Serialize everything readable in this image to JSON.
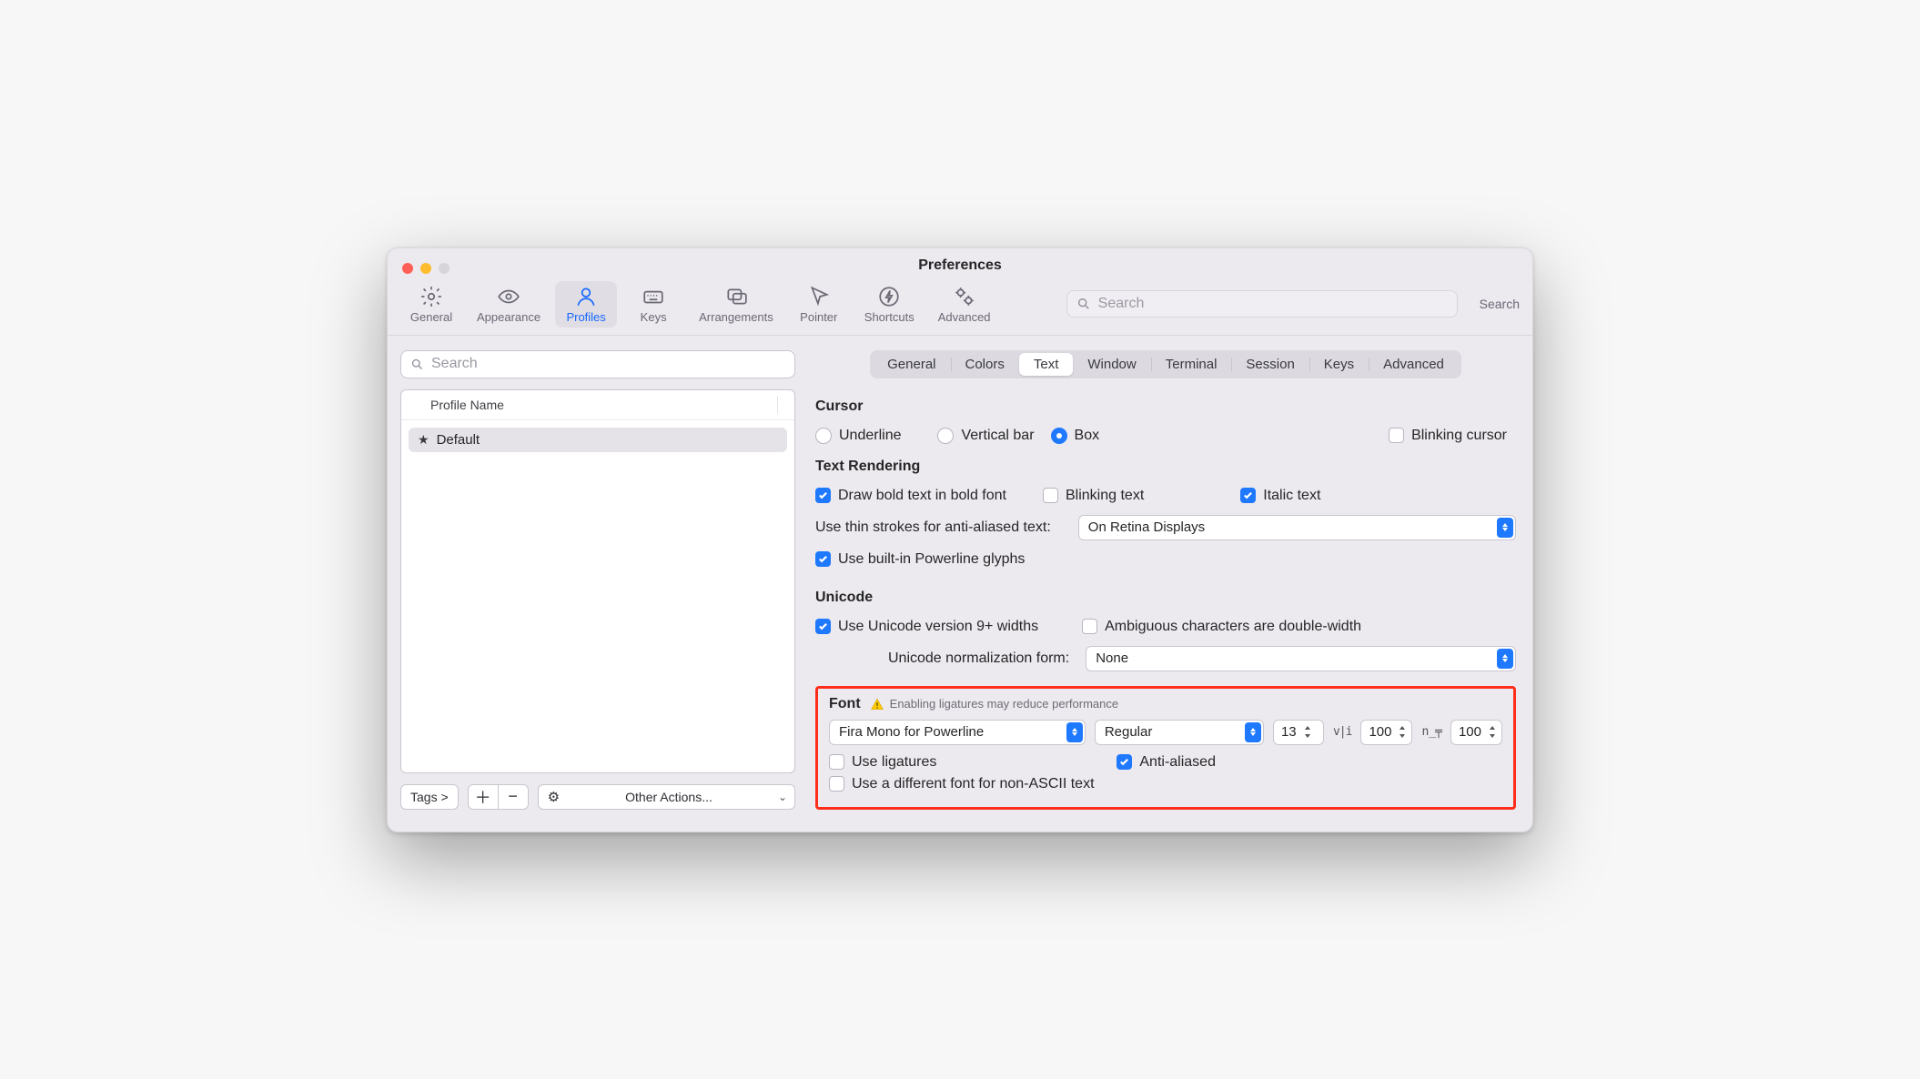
{
  "window": {
    "title": "Preferences"
  },
  "toolbar": {
    "items": [
      {
        "label": "General"
      },
      {
        "label": "Appearance"
      },
      {
        "label": "Profiles"
      },
      {
        "label": "Keys"
      },
      {
        "label": "Arrangements"
      },
      {
        "label": "Pointer"
      },
      {
        "label": "Shortcuts"
      },
      {
        "label": "Advanced"
      }
    ],
    "search_placeholder": "Search",
    "search_label": "Search"
  },
  "sidebar": {
    "search_placeholder": "Search",
    "column_header": "Profile Name",
    "profiles": [
      {
        "name": "Default",
        "starred": true
      }
    ],
    "tags_label": "Tags >",
    "other_actions_label": "Other Actions..."
  },
  "tabs": [
    "General",
    "Colors",
    "Text",
    "Window",
    "Terminal",
    "Session",
    "Keys",
    "Advanced"
  ],
  "active_tab": "Text",
  "cursor": {
    "title": "Cursor",
    "options": [
      "Underline",
      "Vertical bar",
      "Box"
    ],
    "selected": "Box",
    "blinking_label": "Blinking cursor",
    "blinking_checked": false
  },
  "rendering": {
    "title": "Text Rendering",
    "bold_label": "Draw bold text in bold font",
    "bold_checked": true,
    "blinking_label": "Blinking text",
    "blinking_checked": false,
    "italic_label": "Italic text",
    "italic_checked": true,
    "thin_label": "Use thin strokes for anti-aliased text:",
    "thin_value": "On Retina Displays",
    "powerline_label": "Use built-in Powerline glyphs",
    "powerline_checked": true
  },
  "unicode": {
    "title": "Unicode",
    "v9_label": "Use Unicode version 9+ widths",
    "v9_checked": true,
    "ambiguous_label": "Ambiguous characters are double-width",
    "ambiguous_checked": false,
    "norm_label": "Unicode normalization form:",
    "norm_value": "None"
  },
  "font": {
    "title": "Font",
    "warning": "Enabling ligatures may reduce performance",
    "family": "Fira Mono for Powerline",
    "style": "Regular",
    "size": "13",
    "hspacing": "100",
    "vspacing": "100",
    "ligatures_label": "Use ligatures",
    "ligatures_checked": false,
    "antialiased_label": "Anti-aliased",
    "antialiased_checked": true,
    "nonascii_label": "Use a different font for non-ASCII text",
    "nonascii_checked": false
  }
}
